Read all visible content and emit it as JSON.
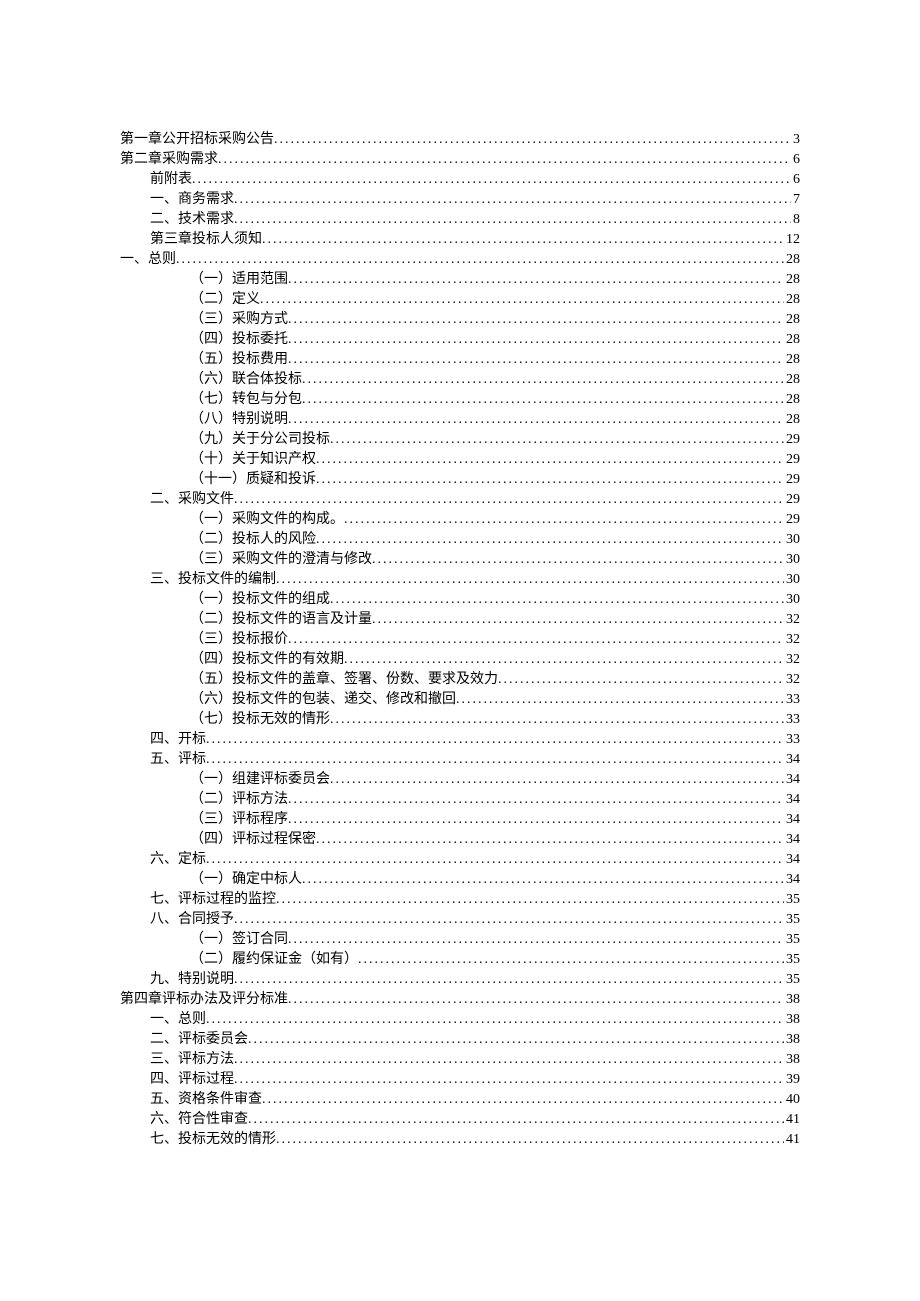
{
  "toc": [
    {
      "label": "第一章公开招标采购公告",
      "page": "3",
      "level": 0
    },
    {
      "label": "第二章采购需求",
      "page": "6",
      "level": 0
    },
    {
      "label": "前附表",
      "page": "6",
      "level": 1
    },
    {
      "label": "一、商务需求",
      "page": "7",
      "level": 1
    },
    {
      "label": "二、技术需求",
      "page": "8",
      "level": 1
    },
    {
      "label": "第三章投标人须知",
      "page": "12",
      "level": 1
    },
    {
      "label": "一、总则",
      "page": "28",
      "level": 0
    },
    {
      "label": "（一）适用范围",
      "page": "28",
      "level": 3
    },
    {
      "label": "（二）定义",
      "page": "28",
      "level": 3
    },
    {
      "label": "（三）采购方式",
      "page": "28",
      "level": 3
    },
    {
      "label": "（四）投标委托",
      "page": "28",
      "level": 3
    },
    {
      "label": "（五）投标费用",
      "page": "28",
      "level": 3
    },
    {
      "label": "（六）联合体投标",
      "page": "28",
      "level": 3
    },
    {
      "label": "（七）转包与分包",
      "page": "28",
      "level": 3
    },
    {
      "label": "（八）特别说明",
      "page": "28",
      "level": 3
    },
    {
      "label": "（九）关于分公司投标",
      "page": "29",
      "level": 3
    },
    {
      "label": "（十）关于知识产权",
      "page": "29",
      "level": 3
    },
    {
      "label": "（十一）质疑和投诉",
      "page": "29",
      "level": 3
    },
    {
      "label": "二、采购文件",
      "page": "29",
      "level": 2
    },
    {
      "label": "（一）采购文件的构成。",
      "page": "29",
      "level": 3
    },
    {
      "label": "（二）投标人的风险",
      "page": "30",
      "level": 3
    },
    {
      "label": "（三）采购文件的澄清与修改",
      "page": "30",
      "level": 3
    },
    {
      "label": "三、投标文件的编制",
      "page": "30",
      "level": 2
    },
    {
      "label": "（一）投标文件的组成",
      "page": "30",
      "level": 3
    },
    {
      "label": "（二）投标文件的语言及计量",
      "page": "32",
      "level": 3
    },
    {
      "label": "（三）投标报价",
      "page": "32",
      "level": 3
    },
    {
      "label": "（四）投标文件的有效期",
      "page": "32",
      "level": 3
    },
    {
      "label": "（五）投标文件的盖章、签署、份数、要求及效力",
      "page": "32",
      "level": 3
    },
    {
      "label": "（六）投标文件的包装、递交、修改和撤回",
      "page": "33",
      "level": 3
    },
    {
      "label": "（七）投标无效的情形",
      "page": "33",
      "level": 3
    },
    {
      "label": "四、开标",
      "page": "33",
      "level": 2
    },
    {
      "label": "五、评标",
      "page": "34",
      "level": 2
    },
    {
      "label": "（一）组建评标委员会",
      "page": "34",
      "level": 3
    },
    {
      "label": "（二）评标方法",
      "page": "34",
      "level": 3
    },
    {
      "label": "（三）评标程序",
      "page": "34",
      "level": 3
    },
    {
      "label": "（四）评标过程保密",
      "page": "34",
      "level": 3
    },
    {
      "label": "六、定标",
      "page": "34",
      "level": 2
    },
    {
      "label": "（一）确定中标人",
      "page": "34",
      "level": 3
    },
    {
      "label": "七、评标过程的监控",
      "page": "35",
      "level": 2
    },
    {
      "label": "八、合同授予",
      "page": "35",
      "level": 2
    },
    {
      "label": "（一）签订合同",
      "page": "35",
      "level": 3
    },
    {
      "label": "（二）履约保证金（如有）",
      "page": "35",
      "level": 3
    },
    {
      "label": "九、特别说明",
      "page": "35",
      "level": 2
    },
    {
      "label": "第四章评标办法及评分标准",
      "page": "38",
      "level": 0
    },
    {
      "label": "一、总则",
      "page": "38",
      "level": 1
    },
    {
      "label": "二、评标委员会",
      "page": "38",
      "level": 1
    },
    {
      "label": "三、评标方法",
      "page": "38",
      "level": 1
    },
    {
      "label": "四、评标过程",
      "page": "39",
      "level": 1
    },
    {
      "label": "五、资格条件审查",
      "page": "40",
      "level": 1
    },
    {
      "label": "六、符合性审查",
      "page": "41",
      "level": 1
    },
    {
      "label": "七、投标无效的情形",
      "page": "41",
      "level": 1
    }
  ]
}
